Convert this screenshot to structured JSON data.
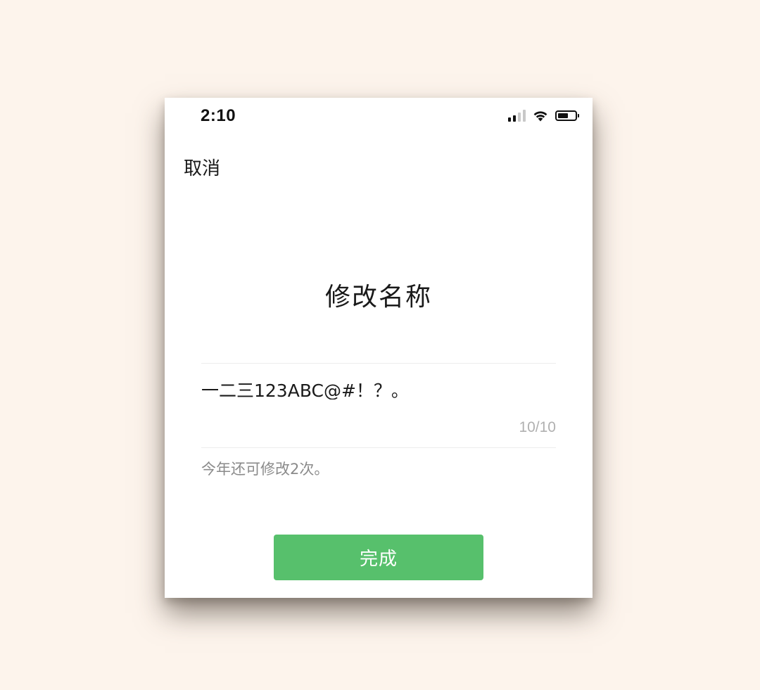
{
  "status_bar": {
    "time": "2:10",
    "signal_bars_active": 2,
    "signal_bars_total": 4,
    "battery_level": 0.6
  },
  "header": {
    "cancel_label": "取消"
  },
  "main": {
    "title": "修改名称",
    "name_value": "一二三123ABC@#！？。",
    "counter": "10/10",
    "hint": "今年还可修改2次。"
  },
  "footer": {
    "done_label": "完成"
  },
  "colors": {
    "accent_green": "#57c06c",
    "background": "#fdf4ec"
  }
}
